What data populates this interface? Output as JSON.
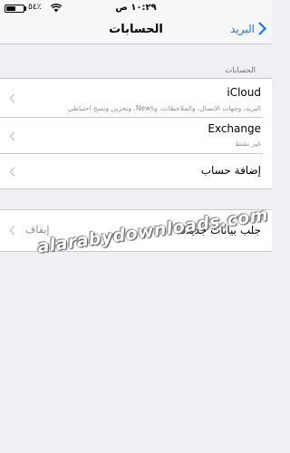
{
  "status_bar": {
    "time": "١٠:٢٩ ص",
    "battery_percent": "٥٤٪",
    "battery_level": 0.54,
    "icons": [
      "wifi-icon",
      "battery-icon"
    ]
  },
  "nav": {
    "title": "الحسابات",
    "back_label": "البريد",
    "accent_color": "#007aff"
  },
  "accounts_section": {
    "header": "الحسابات",
    "rows": [
      {
        "title": "iCloud",
        "subtitle": "البريد، وجهات الاتصال، والملاحظات، وNews، وتخزين ونسخ احتياطي"
      },
      {
        "title": "Exchange",
        "subtitle": "غير نشط"
      },
      {
        "title": "إضافة حساب"
      }
    ]
  },
  "fetch_section": {
    "label": "جلب بيانات جديدة",
    "value": "إيقاف"
  },
  "watermark": "alarabydownloads.com"
}
